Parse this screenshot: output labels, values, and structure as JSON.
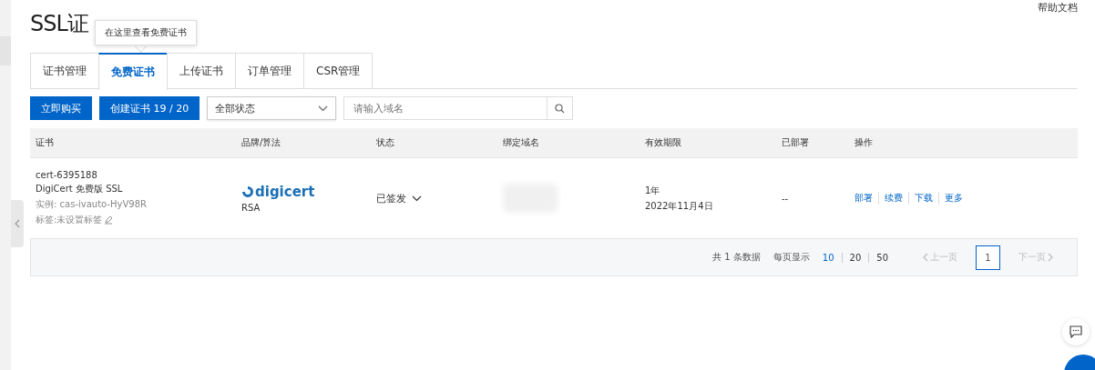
{
  "page": {
    "title": "SSL证",
    "help_link": "帮助文档"
  },
  "tooltip": {
    "text": "在这里查看免费证书"
  },
  "tabs": [
    {
      "label": "证书管理",
      "selected": false
    },
    {
      "label": "免费证书",
      "selected": true
    },
    {
      "label": "上传证书",
      "selected": false
    },
    {
      "label": "订单管理",
      "selected": false
    },
    {
      "label": "CSR管理",
      "selected": false
    }
  ],
  "toolbar": {
    "buy_button": "立即购买",
    "create_button": "创建证书 19 / 20",
    "status_select": "全部状态",
    "search": {
      "placeholder": "请输入域名"
    }
  },
  "table": {
    "columns": [
      "证书",
      "品牌/算法",
      "状态",
      "绑定域名",
      "有效期限",
      "已部署",
      "操作"
    ],
    "rows": [
      {
        "cert_id": "cert-6395188",
        "cert_name": "DigiCert 免费版 SSL",
        "instance": "实例: cas-ivauto-HyV98R",
        "tag": "标签:未设置标签",
        "brand": "digicert",
        "algorithm": "RSA",
        "status": "已签发",
        "validity": "1年",
        "expiry": "2022年11月4日",
        "deployed": "--",
        "actions": [
          "部署",
          "续费",
          "下载",
          "更多"
        ]
      }
    ]
  },
  "pagination": {
    "total": "共 1 条数据",
    "page_size_label": "每页显示",
    "page_sizes": [
      {
        "label": "10",
        "selected": true
      },
      {
        "label": "20",
        "selected": false
      },
      {
        "label": "50",
        "selected": false
      }
    ],
    "prev": "上一页",
    "pages": [
      {
        "label": "1",
        "selected": true
      }
    ],
    "next": "下一页"
  }
}
